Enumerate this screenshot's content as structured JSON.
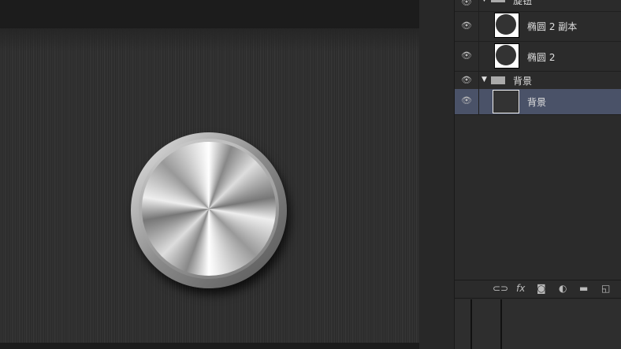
{
  "layers": [
    {
      "name": "旋钮",
      "type": "group",
      "expanded": true
    },
    {
      "name": "椭圆 2 副本",
      "type": "shape"
    },
    {
      "name": "椭圆 2",
      "type": "shape"
    },
    {
      "name": "背景",
      "type": "group",
      "expanded": true
    },
    {
      "name": "背景",
      "type": "pixel",
      "selected": true
    }
  ],
  "footer_icons": [
    "link-icon",
    "fx-icon",
    "mask-icon",
    "adjustment-icon",
    "folder-icon",
    "new-layer-icon"
  ],
  "fx_label": "fx"
}
